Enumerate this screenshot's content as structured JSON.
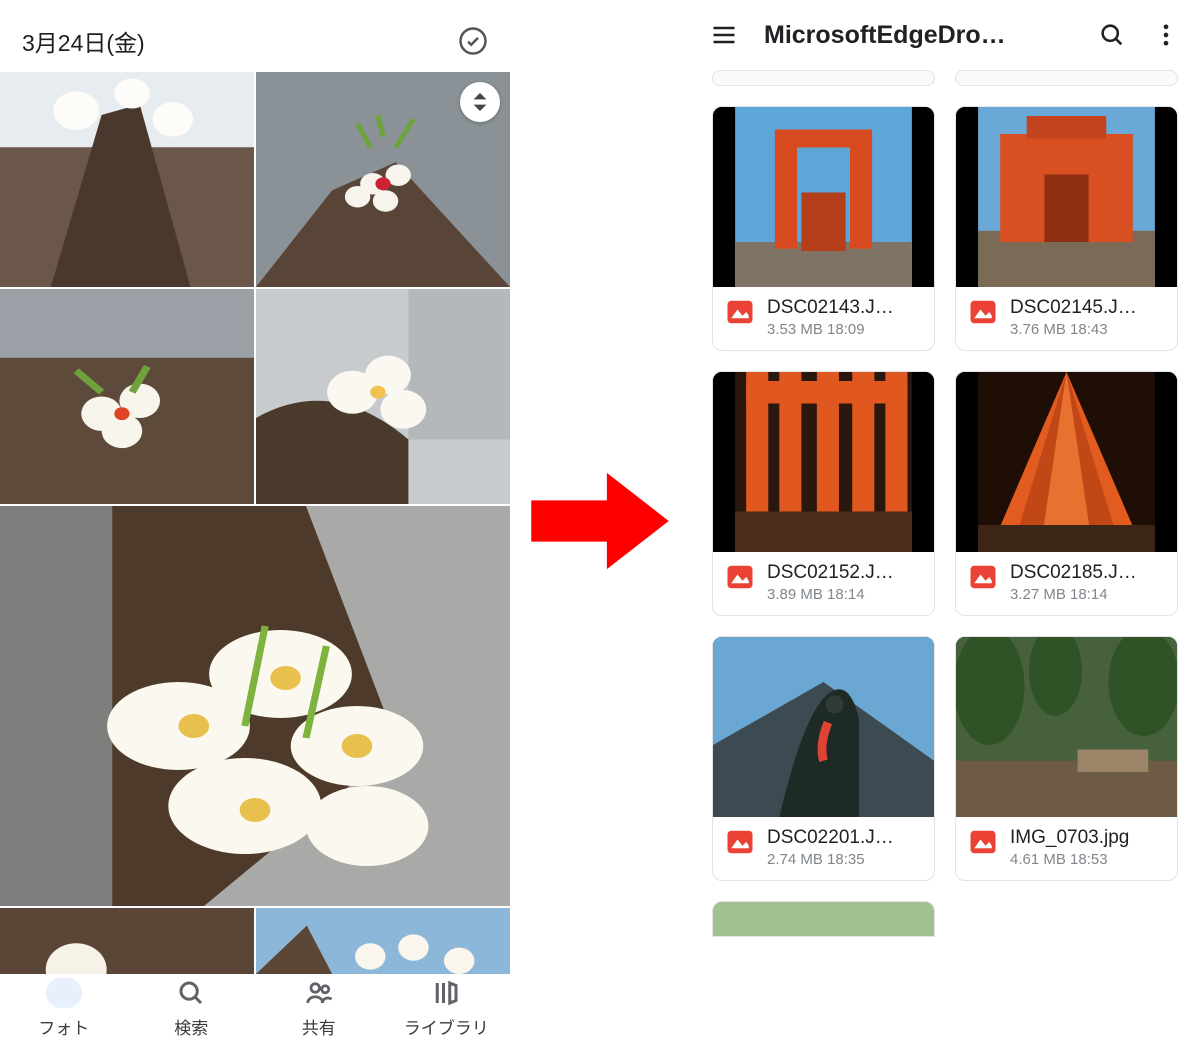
{
  "photos": {
    "date_header": "3月24日(金)",
    "nav": [
      {
        "label": "フォト",
        "active": true
      },
      {
        "label": "検索",
        "active": false
      },
      {
        "label": "共有",
        "active": false
      },
      {
        "label": "ライブラリ",
        "active": false
      }
    ]
  },
  "files": {
    "title": "MicrosoftEdgeDro…",
    "items": [
      {
        "name": "DSC02143.J…",
        "sub": "3.53 MB 18:09"
      },
      {
        "name": "DSC02145.J…",
        "sub": "3.76 MB 18:43"
      },
      {
        "name": "DSC02152.J…",
        "sub": "3.89 MB 18:14"
      },
      {
        "name": "DSC02185.J…",
        "sub": "3.27 MB 18:14"
      },
      {
        "name": "DSC02201.J…",
        "sub": "2.74 MB 18:35"
      },
      {
        "name": "IMG_0703.jpg",
        "sub": "4.61 MB 18:53"
      }
    ]
  }
}
